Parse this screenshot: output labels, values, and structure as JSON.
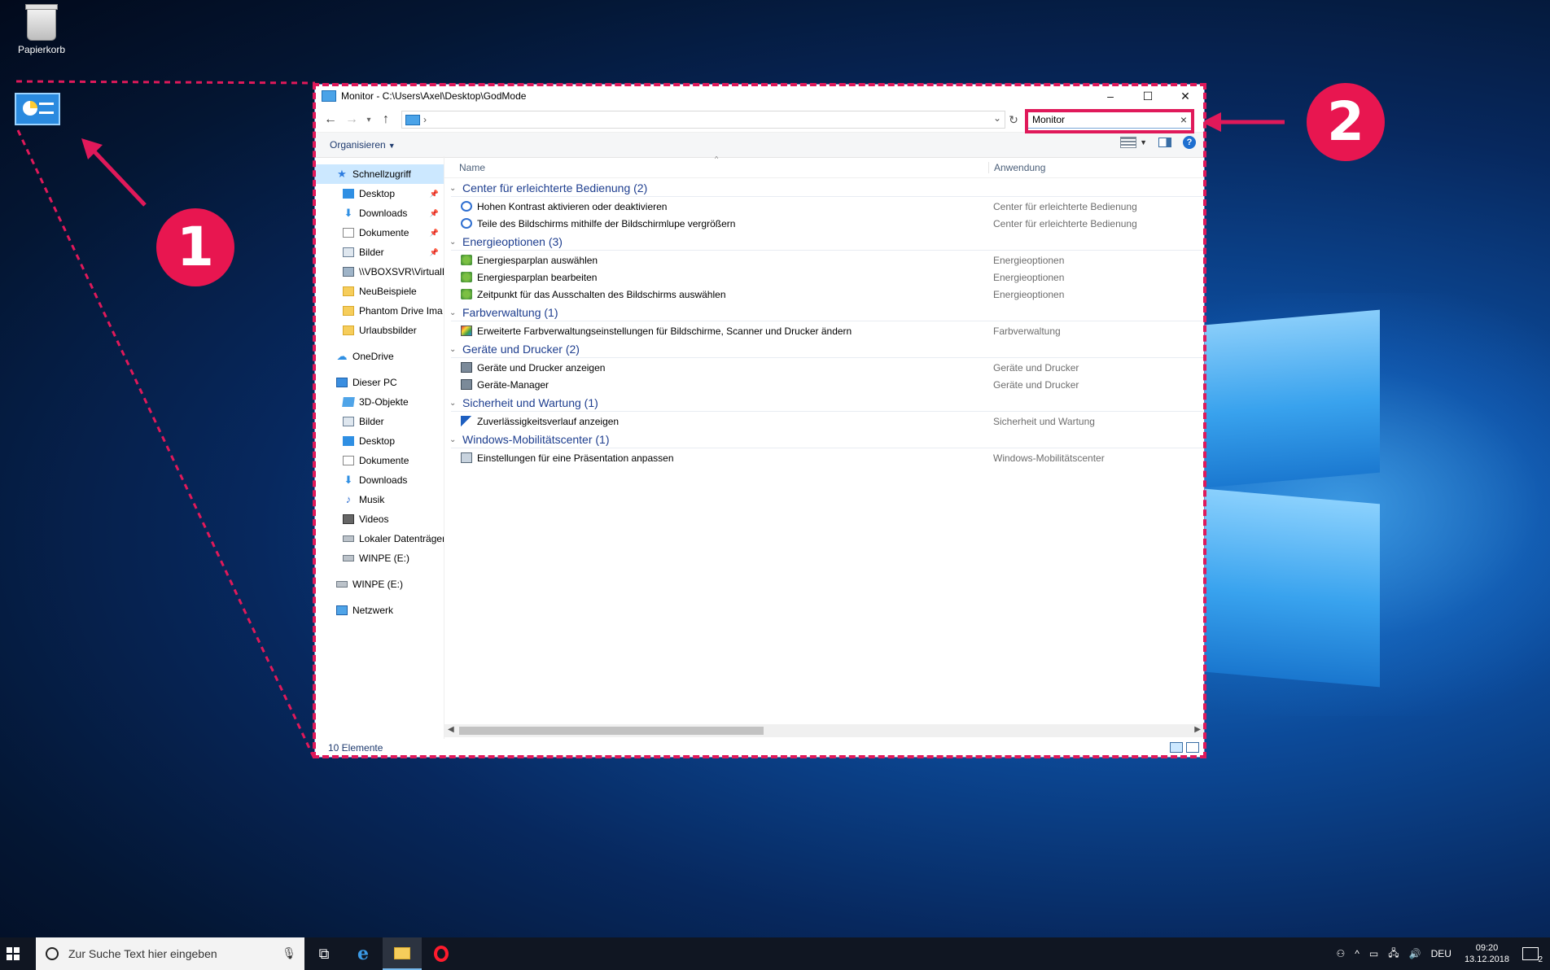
{
  "desktop": {
    "recycle_bin_label": "Papierkorb",
    "badge_1": "1",
    "badge_2": "2",
    "annotation_color": "#e0195a"
  },
  "window": {
    "title": "Monitor - C:\\Users\\Axel\\Desktop\\GodMode",
    "address_separator": "›",
    "search_value": "Monitor",
    "search_clear": "×",
    "organize_label": "Organisieren",
    "status": "10 Elemente",
    "controls": {
      "minimize": "–",
      "maximize": "☐",
      "close": "✕"
    }
  },
  "nav": {
    "quick_access": "Schnellzugriff",
    "quick_items": [
      "Desktop",
      "Downloads",
      "Dokumente",
      "Bilder",
      "\\\\VBOXSVR\\VirtualE",
      "NeuBeispiele",
      "Phantom Drive Ima",
      "Urlaubsbilder"
    ],
    "onedrive": "OneDrive",
    "this_pc": "Dieser PC",
    "pc_items": [
      "3D-Objekte",
      "Bilder",
      "Desktop",
      "Dokumente",
      "Downloads",
      "Musik",
      "Videos",
      "Lokaler Datenträger",
      "WINPE (E:)"
    ],
    "winpe": "WINPE (E:)",
    "network": "Netzwerk"
  },
  "columns": {
    "name": "Name",
    "app": "Anwendung"
  },
  "groups": [
    {
      "title": "Center für erleichterte Bedienung (2)",
      "items": [
        {
          "name": "Hohen Kontrast aktivieren oder deaktivieren",
          "app": "Center für erleichterte Bedienung"
        },
        {
          "name": "Teile des Bildschirms mithilfe der Bildschirmlupe vergrößern",
          "app": "Center für erleichterte Bedienung"
        }
      ]
    },
    {
      "title": "Energieoptionen (3)",
      "items": [
        {
          "name": "Energiesparplan auswählen",
          "app": "Energieoptionen"
        },
        {
          "name": "Energiesparplan bearbeiten",
          "app": "Energieoptionen"
        },
        {
          "name": "Zeitpunkt für das Ausschalten des Bildschirms auswählen",
          "app": "Energieoptionen"
        }
      ]
    },
    {
      "title": "Farbverwaltung (1)",
      "items": [
        {
          "name": "Erweiterte Farbverwaltungseinstellungen für Bildschirme, Scanner und Drucker ändern",
          "app": "Farbverwaltung"
        }
      ]
    },
    {
      "title": "Geräte und Drucker (2)",
      "items": [
        {
          "name": "Geräte und Drucker anzeigen",
          "app": "Geräte und Drucker"
        },
        {
          "name": "Geräte-Manager",
          "app": "Geräte und Drucker"
        }
      ]
    },
    {
      "title": "Sicherheit und Wartung (1)",
      "items": [
        {
          "name": "Zuverlässigkeitsverlauf anzeigen",
          "app": "Sicherheit und Wartung"
        }
      ]
    },
    {
      "title": "Windows-Mobilitätscenter (1)",
      "items": [
        {
          "name": "Einstellungen für eine Präsentation anpassen",
          "app": "Windows-Mobilitätscenter"
        }
      ]
    }
  ],
  "taskbar": {
    "search_placeholder": "Zur Suche Text hier eingeben",
    "language": "DEU",
    "time": "09:20",
    "date": "13.12.2018",
    "notification_count": "2"
  }
}
